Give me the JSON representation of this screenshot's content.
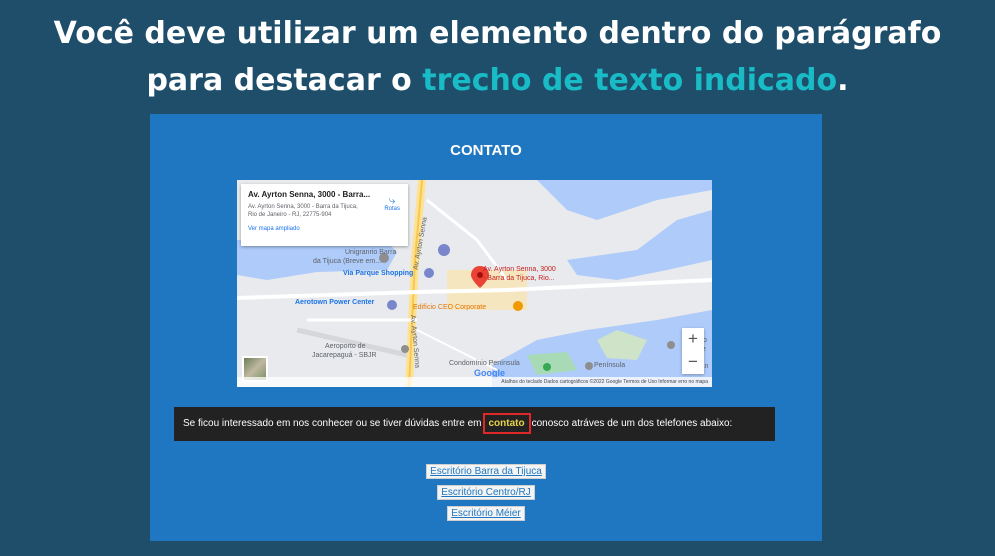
{
  "headline": {
    "line1": "Você deve utilizar um elemento dentro do parágrafo",
    "line2_pre": "para destacar o ",
    "line2_highlight": "trecho de texto indicado",
    "line2_post": ".",
    "highlight_color": "#19bcc6"
  },
  "panel": {
    "title": "CONTATO",
    "background": "#1e77c0"
  },
  "map": {
    "card_title": "Av. Ayrton Senna, 3000 - Barra...",
    "card_address": "Av. Ayrton Senna, 3000 - Barra da Tijuca, Rio de Janeiro - RJ, 22775-904",
    "card_link": "Ver mapa ampliado",
    "routes_label": "Rotas",
    "routes_icon": "directions-icon",
    "labels": {
      "unigranrio": "Unigranrio Barra",
      "unigranrio2": "da Tijuca (Breve em...",
      "via_parque": "Via Parque Shopping",
      "aerotown": "Aerotown Power Center",
      "marker": "Av. Ayrton Senna, 3000",
      "marker2": "- Barra da Tijuca, Rio...",
      "edificio": "Edifício CEO Corporate",
      "aeroporto": "Aeroporto de",
      "aeroporto2": "Jacarepaguá - SBJR",
      "condominio": "Condomínio Península",
      "peninsula": "Península",
      "road1": "Av. Ayrton Senna",
      "road2": "Av. Ayrton Senna",
      "pro": "Pro",
      "de": "de",
      "san": "San"
    },
    "zoom_in": "+",
    "zoom_out": "−",
    "google": "Google",
    "attribution": "Atalhos do teclado   Dados cartográficos ©2022 Google   Termos de Uso   Informar erro no mapa"
  },
  "text": {
    "before": "Se ficou interessado em nos conhecer ou se tiver dúvidas entre em",
    "highlight": "contato",
    "after": "conosco atráves de um dos telefones abaixo:"
  },
  "links": [
    "Escritório Barra da Tijuca",
    "Escritório Centro/RJ",
    "Escritório Méier"
  ]
}
